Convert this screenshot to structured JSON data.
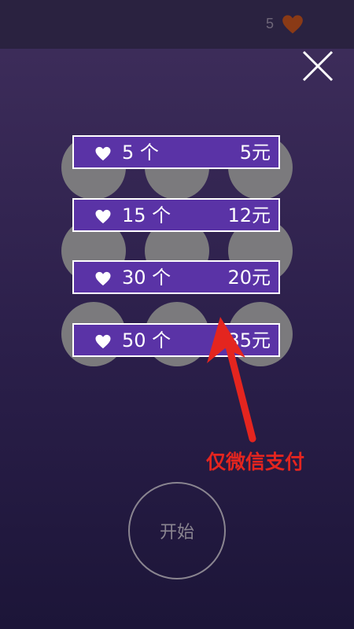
{
  "hud": {
    "lives": "5"
  },
  "offers": [
    {
      "qty": "5 个",
      "price": "5元"
    },
    {
      "qty": "15 个",
      "price": "12元"
    },
    {
      "qty": "30 个",
      "price": "20元"
    },
    {
      "qty": "50 个",
      "price": "35元"
    }
  ],
  "note": "仅微信支付",
  "start_label": "开始",
  "colors": {
    "offer_bg": "#5a33a6",
    "lives_heart": "#8a3a16",
    "note": "#e4251f",
    "circle": "#7b7a7d"
  }
}
